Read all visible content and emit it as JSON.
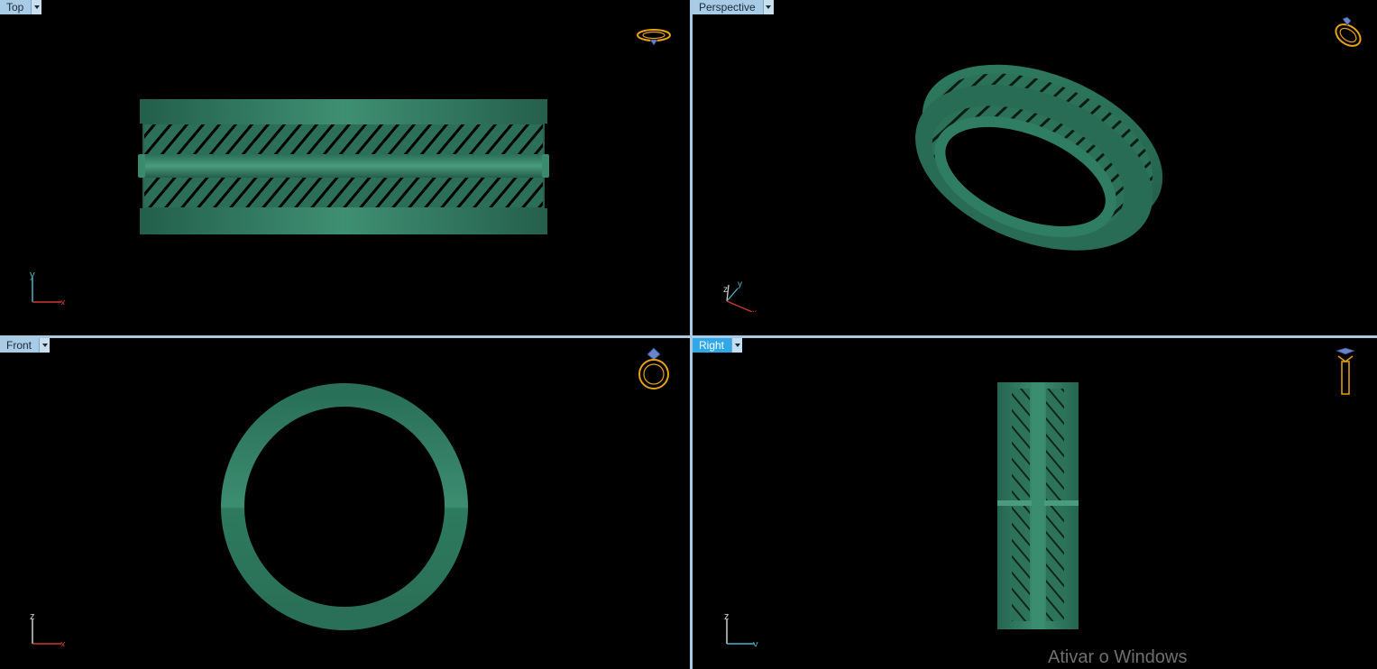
{
  "viewports": {
    "top": {
      "label": "Top",
      "axes": [
        "y",
        "x"
      ]
    },
    "perspective": {
      "label": "Perspective",
      "axes": [
        "z",
        "y",
        "x"
      ]
    },
    "front": {
      "label": "Front",
      "axes": [
        "z",
        "x"
      ]
    },
    "right": {
      "label": "Right",
      "axes": [
        "z",
        "y"
      ],
      "active": true
    }
  },
  "colors": {
    "model": "#2f7d62",
    "axis_x": "#cc3a2a",
    "axis_y": "#4fb3c4",
    "axis_z": "#cfcfcf",
    "separator": "#aac9e3",
    "active_tab": "#2ea8e8",
    "icon": "#e8a21a"
  },
  "icons": [
    "ring-top-view-icon",
    "ring-perspective-icon",
    "ring-front-view-icon",
    "ring-side-view-icon"
  ],
  "watermark": "Ativar o Windows"
}
